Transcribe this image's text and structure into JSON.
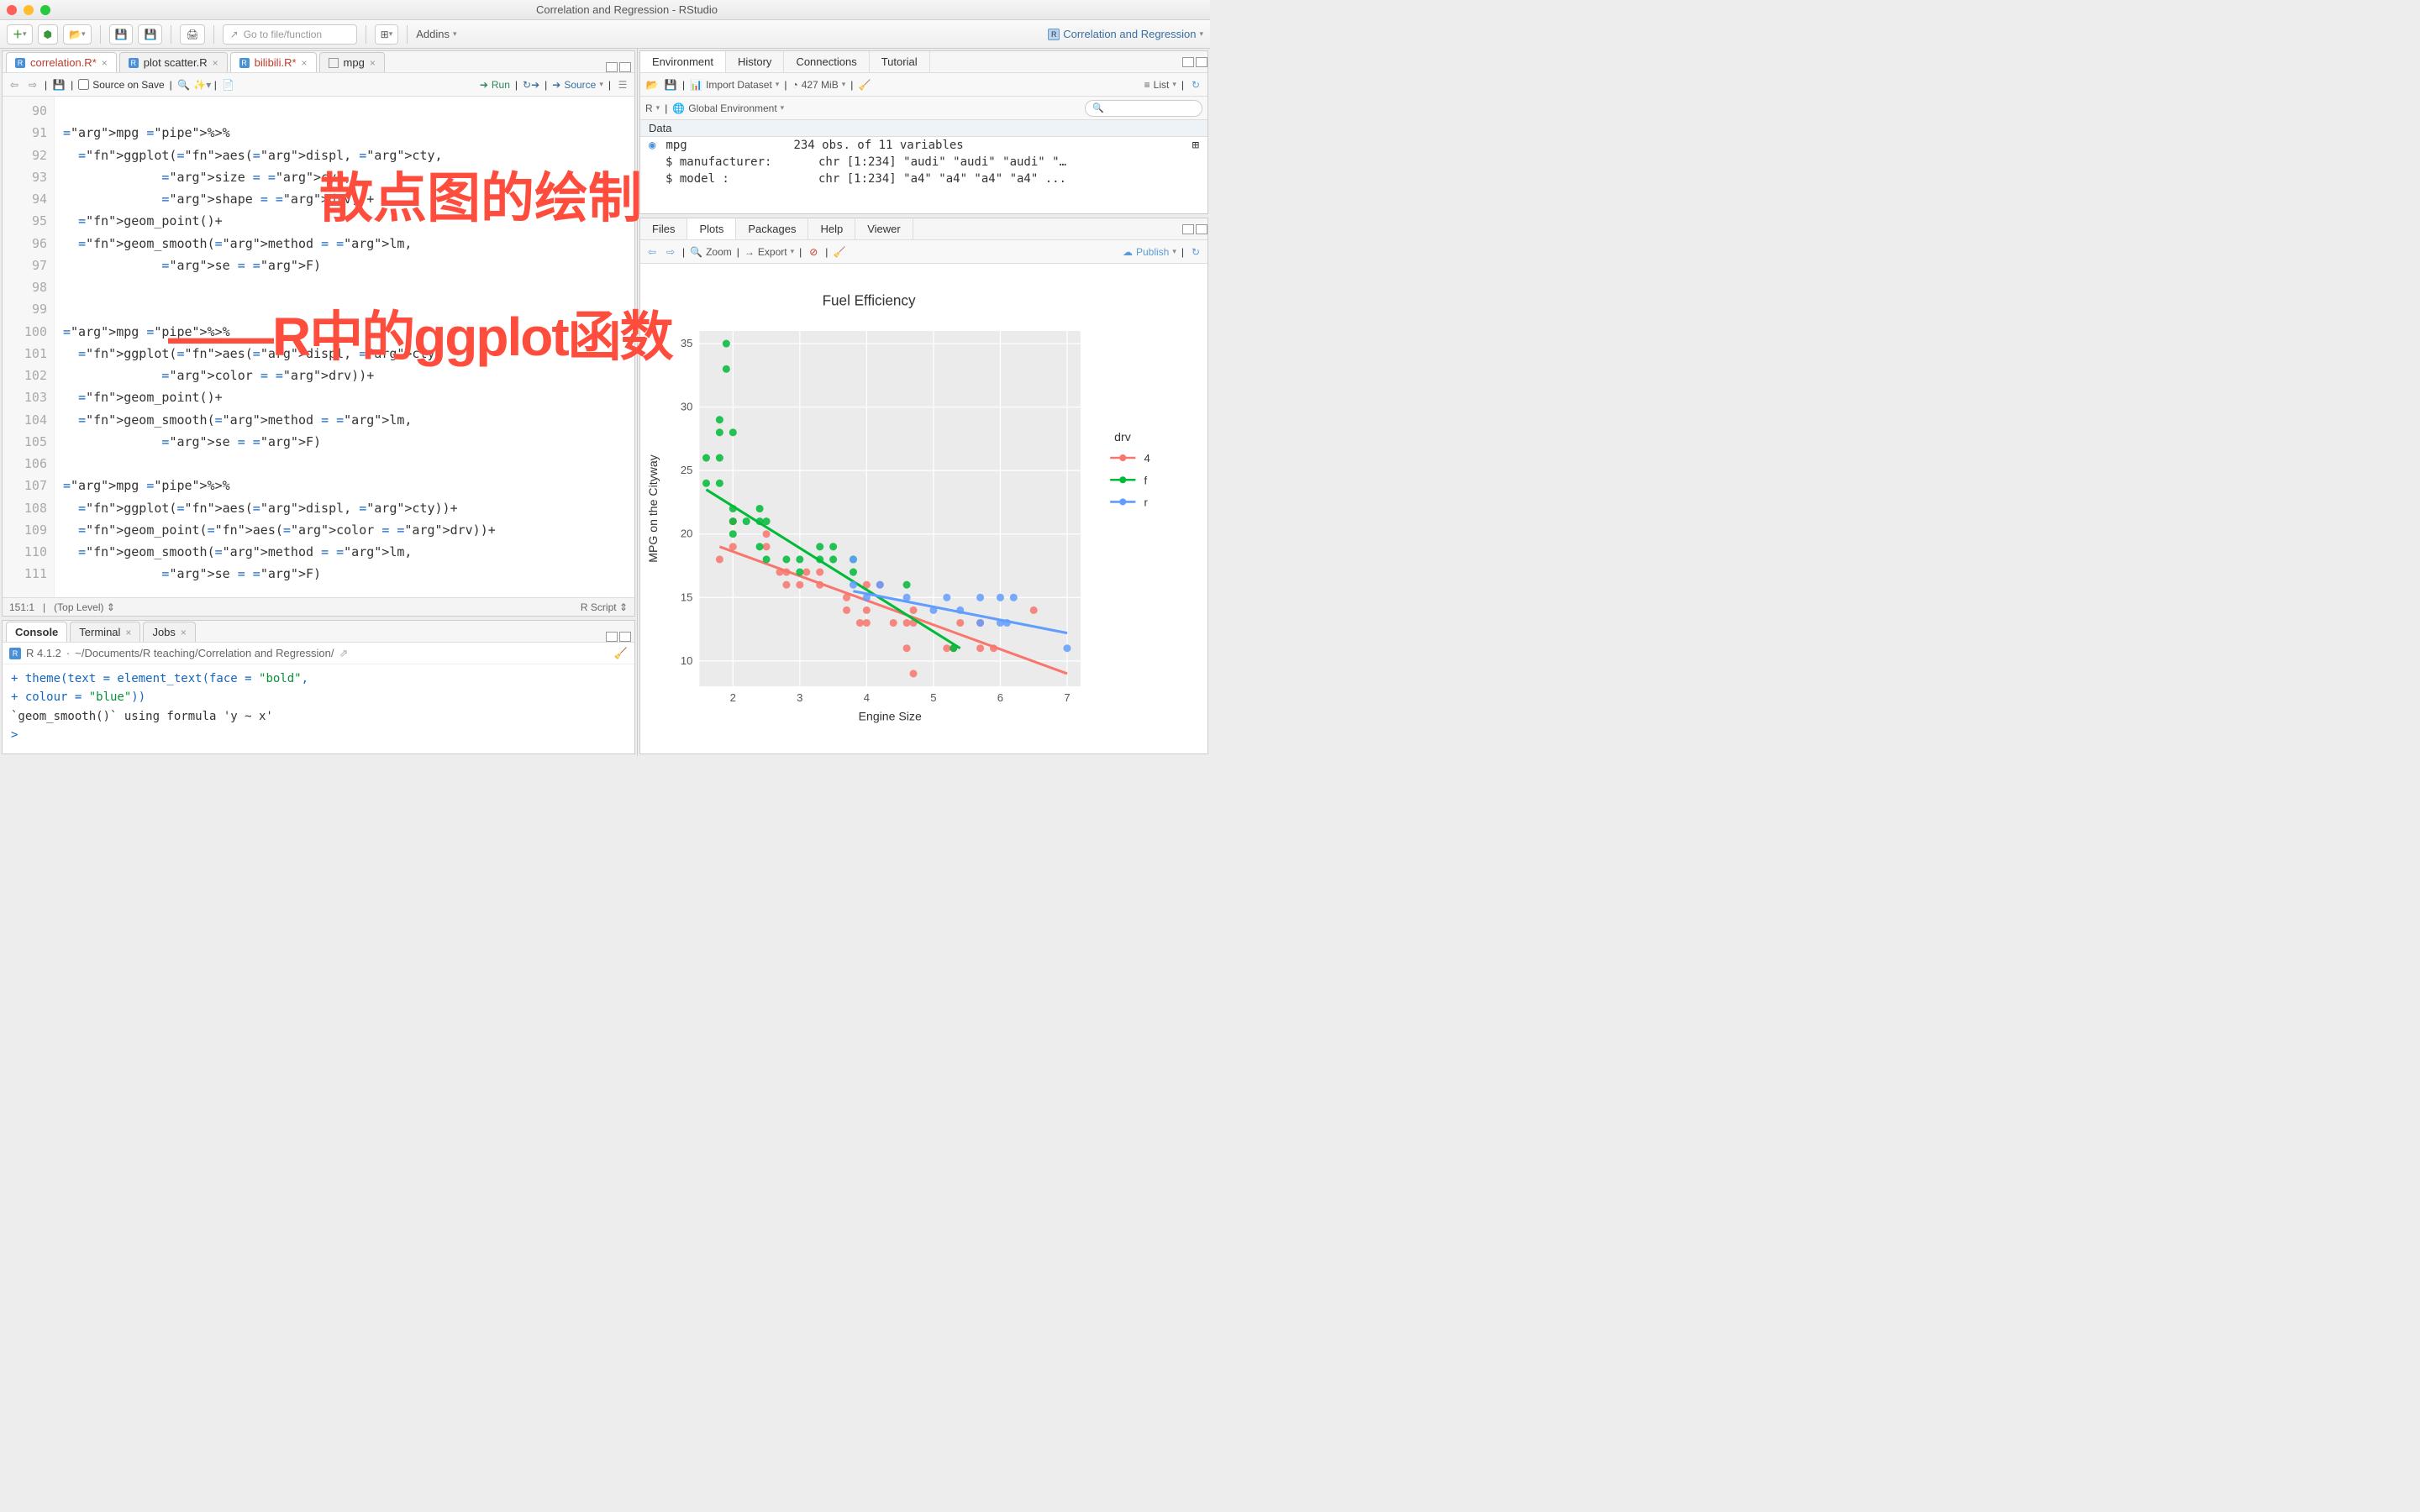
{
  "window": {
    "title": "Correlation and Regression - RStudio"
  },
  "toolbar": {
    "go_to_file_placeholder": "Go to file/function",
    "addins_label": "Addins",
    "project_label": "Correlation and Regression"
  },
  "editor": {
    "tabs": [
      {
        "label": "correlation.R*",
        "modified": true,
        "icon": "r"
      },
      {
        "label": "plot scatter.R",
        "modified": false,
        "icon": "r"
      },
      {
        "label": "bilibili.R*",
        "modified": true,
        "icon": "r"
      },
      {
        "label": "mpg",
        "modified": false,
        "icon": "table"
      }
    ],
    "toolbar": {
      "source_on_save": "Source on Save",
      "run": "Run",
      "source": "Source"
    },
    "lines_start": 90,
    "lines": [
      "",
      "mpg %>%",
      "  ggplot(aes(displ, cty,",
      "             size = cyl,",
      "             shape = drv))+",
      "  geom_point()+",
      "  geom_smooth(method = lm,",
      "             se = F)",
      "",
      "",
      "mpg %>%",
      "  ggplot(aes(displ, cty,",
      "             color = drv))+",
      "  geom_point()+",
      "  geom_smooth(method = lm,",
      "             se = F)",
      "",
      "mpg %>%",
      "  ggplot(aes(displ, cty))+",
      "  geom_point(aes(color = drv))+",
      "  geom_smooth(method = lm,",
      "             se = F)"
    ],
    "cursor_pos": "151:1",
    "scope": "(Top Level)",
    "lang": "R Script"
  },
  "console": {
    "tabs": [
      "Console",
      "Terminal",
      "Jobs"
    ],
    "r_version": "R 4.1.2",
    "wd": "~/Documents/R teaching/Correlation and Regression/",
    "lines": [
      {
        "prefix": "+",
        "text": "  theme(text = element_text(face = \"bold\","
      },
      {
        "prefix": "+",
        "text": "                            colour = \"blue\"))"
      },
      {
        "prefix": "",
        "text": "`geom_smooth()` using formula 'y ~ x'"
      },
      {
        "prefix": ">",
        "text": ""
      }
    ]
  },
  "environment": {
    "tabs": [
      "Environment",
      "History",
      "Connections",
      "Tutorial"
    ],
    "toolbar": {
      "import_dataset": "Import Dataset",
      "memory": "427 MiB",
      "view_mode": "List",
      "scope_r": "R",
      "scope_env": "Global Environment"
    },
    "section": "Data",
    "rows": [
      {
        "name": "mpg",
        "value": "234 obs. of 11 variables",
        "expandable": true
      },
      {
        "name": "$ manufacturer:",
        "value": "chr [1:234] \"audi\" \"audi\" \"audi\" \"…",
        "sub": true
      },
      {
        "name": "$ model      :",
        "value": "chr [1:234] \"a4\" \"a4\" \"a4\" \"a4\" ...",
        "sub": true
      }
    ]
  },
  "viewer": {
    "tabs": [
      "Files",
      "Plots",
      "Packages",
      "Help",
      "Viewer"
    ],
    "toolbar": {
      "zoom": "Zoom",
      "export": "Export",
      "publish": "Publish"
    }
  },
  "overlay": {
    "line1": "散点图的绘制",
    "line2": "——R中的ggplot函数"
  },
  "chart_data": {
    "type": "scatter",
    "title": "Fuel Efficiency",
    "xlabel": "Engine Size",
    "ylabel": "MPG on the Cityway",
    "xlim": [
      1.5,
      7.2
    ],
    "ylim": [
      8,
      36
    ],
    "y_ticks": [
      10,
      15,
      20,
      25,
      30,
      35
    ],
    "x_ticks": [
      2,
      3,
      4,
      5,
      6,
      7
    ],
    "legend_title": "drv",
    "series": [
      {
        "name": "4",
        "color": "#F8766D",
        "points": [
          [
            1.8,
            18
          ],
          [
            2.0,
            19
          ],
          [
            2.0,
            21
          ],
          [
            2.5,
            19
          ],
          [
            2.5,
            20
          ],
          [
            2.7,
            17
          ],
          [
            2.8,
            16
          ],
          [
            2.8,
            17
          ],
          [
            3.0,
            16
          ],
          [
            3.1,
            17
          ],
          [
            3.3,
            16
          ],
          [
            3.3,
            17
          ],
          [
            3.7,
            15
          ],
          [
            3.7,
            14
          ],
          [
            3.9,
            13
          ],
          [
            4.0,
            14
          ],
          [
            4.0,
            16
          ],
          [
            4.0,
            13
          ],
          [
            4.2,
            16
          ],
          [
            4.4,
            13
          ],
          [
            4.6,
            13
          ],
          [
            4.6,
            11
          ],
          [
            4.7,
            13
          ],
          [
            4.7,
            14
          ],
          [
            4.7,
            9
          ],
          [
            5.2,
            11
          ],
          [
            5.3,
            11
          ],
          [
            5.4,
            13
          ],
          [
            5.7,
            11
          ],
          [
            5.7,
            13
          ],
          [
            5.9,
            11
          ],
          [
            6.5,
            14
          ]
        ],
        "trend": {
          "x1": 1.8,
          "y1": 19.0,
          "x2": 7.0,
          "y2": 9.0
        }
      },
      {
        "name": "f",
        "color": "#00BA38",
        "points": [
          [
            1.6,
            24
          ],
          [
            1.6,
            26
          ],
          [
            1.8,
            24
          ],
          [
            1.8,
            26
          ],
          [
            1.8,
            29
          ],
          [
            1.8,
            28
          ],
          [
            1.9,
            33
          ],
          [
            1.9,
            35
          ],
          [
            2.0,
            22
          ],
          [
            2.0,
            21
          ],
          [
            2.0,
            28
          ],
          [
            2.0,
            20
          ],
          [
            2.2,
            21
          ],
          [
            2.4,
            21
          ],
          [
            2.4,
            22
          ],
          [
            2.4,
            19
          ],
          [
            2.5,
            21
          ],
          [
            2.5,
            18
          ],
          [
            2.8,
            18
          ],
          [
            3.0,
            18
          ],
          [
            3.0,
            17
          ],
          [
            3.3,
            19
          ],
          [
            3.3,
            18
          ],
          [
            3.5,
            18
          ],
          [
            3.5,
            19
          ],
          [
            3.8,
            17
          ],
          [
            3.8,
            18
          ],
          [
            4.6,
            16
          ],
          [
            5.3,
            11
          ]
        ],
        "trend": {
          "x1": 1.6,
          "y1": 23.5,
          "x2": 5.4,
          "y2": 11.0
        }
      },
      {
        "name": "r",
        "color": "#619CFF",
        "points": [
          [
            3.8,
            16
          ],
          [
            3.8,
            18
          ],
          [
            4.0,
            15
          ],
          [
            4.2,
            16
          ],
          [
            4.6,
            15
          ],
          [
            5.0,
            14
          ],
          [
            5.2,
            15
          ],
          [
            5.4,
            14
          ],
          [
            5.7,
            15
          ],
          [
            5.7,
            13
          ],
          [
            6.0,
            13
          ],
          [
            6.0,
            15
          ],
          [
            6.1,
            13
          ],
          [
            6.2,
            15
          ],
          [
            7.0,
            11
          ]
        ],
        "trend": {
          "x1": 3.8,
          "y1": 15.5,
          "x2": 7.0,
          "y2": 12.2
        }
      }
    ]
  }
}
